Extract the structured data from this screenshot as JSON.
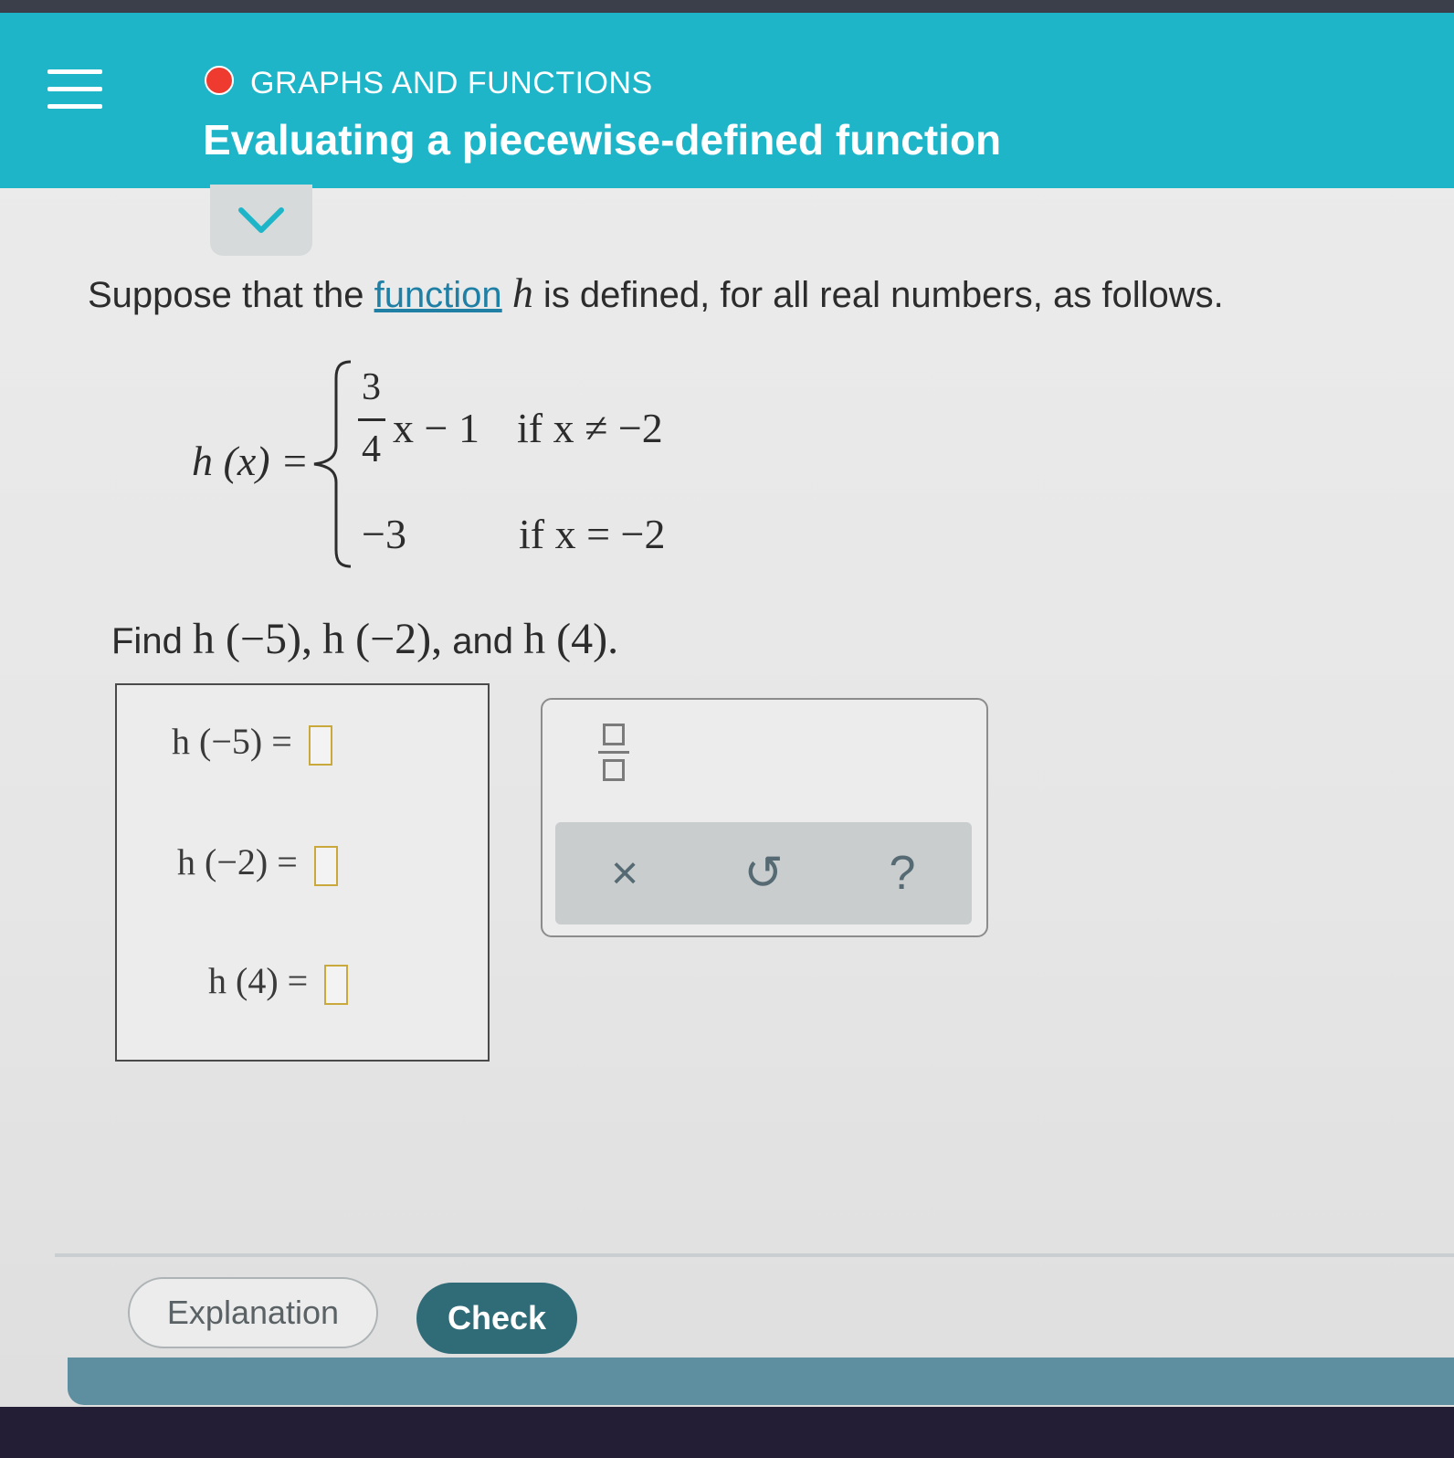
{
  "header": {
    "category": "GRAPHS AND FUNCTIONS",
    "title": "Evaluating a piecewise-defined function"
  },
  "colors": {
    "header_bg": "#1eb5c9",
    "status_dot": "#ef3b2f",
    "check_button": "#2f6c78",
    "link": "#1f7fa4"
  },
  "icons": {
    "menu": "hamburger-icon",
    "collapse": "chevron-down-icon",
    "fraction": "fraction-icon",
    "clear": "close-icon",
    "undo": "undo-icon",
    "help": "question-icon"
  },
  "problem": {
    "prompt_before": "Suppose that the ",
    "prompt_link": "function",
    "prompt_var": "h",
    "prompt_after": " is defined, for all real numbers, as follows.",
    "lhs": "h (x) =",
    "case1_num": "3",
    "case1_den": "4",
    "case1_rest": "x − 1",
    "case1_cond": "if x ≠ −2",
    "case2_expr": "−3",
    "case2_cond": "if x = −2",
    "find_text": "Find",
    "find_h1": "h (−5),",
    "find_h2": "h (−2),",
    "find_and": "and",
    "find_h3": "h (4)."
  },
  "answers": [
    {
      "label": "h (−5) =",
      "value": ""
    },
    {
      "label": "h (−2) =",
      "value": ""
    },
    {
      "label": "h (4) =",
      "value": ""
    }
  ],
  "keypad": {
    "clear_symbol": "×",
    "undo_symbol": "↺",
    "help_symbol": "?"
  },
  "buttons": {
    "explanation": "Explanation",
    "check": "Check"
  }
}
